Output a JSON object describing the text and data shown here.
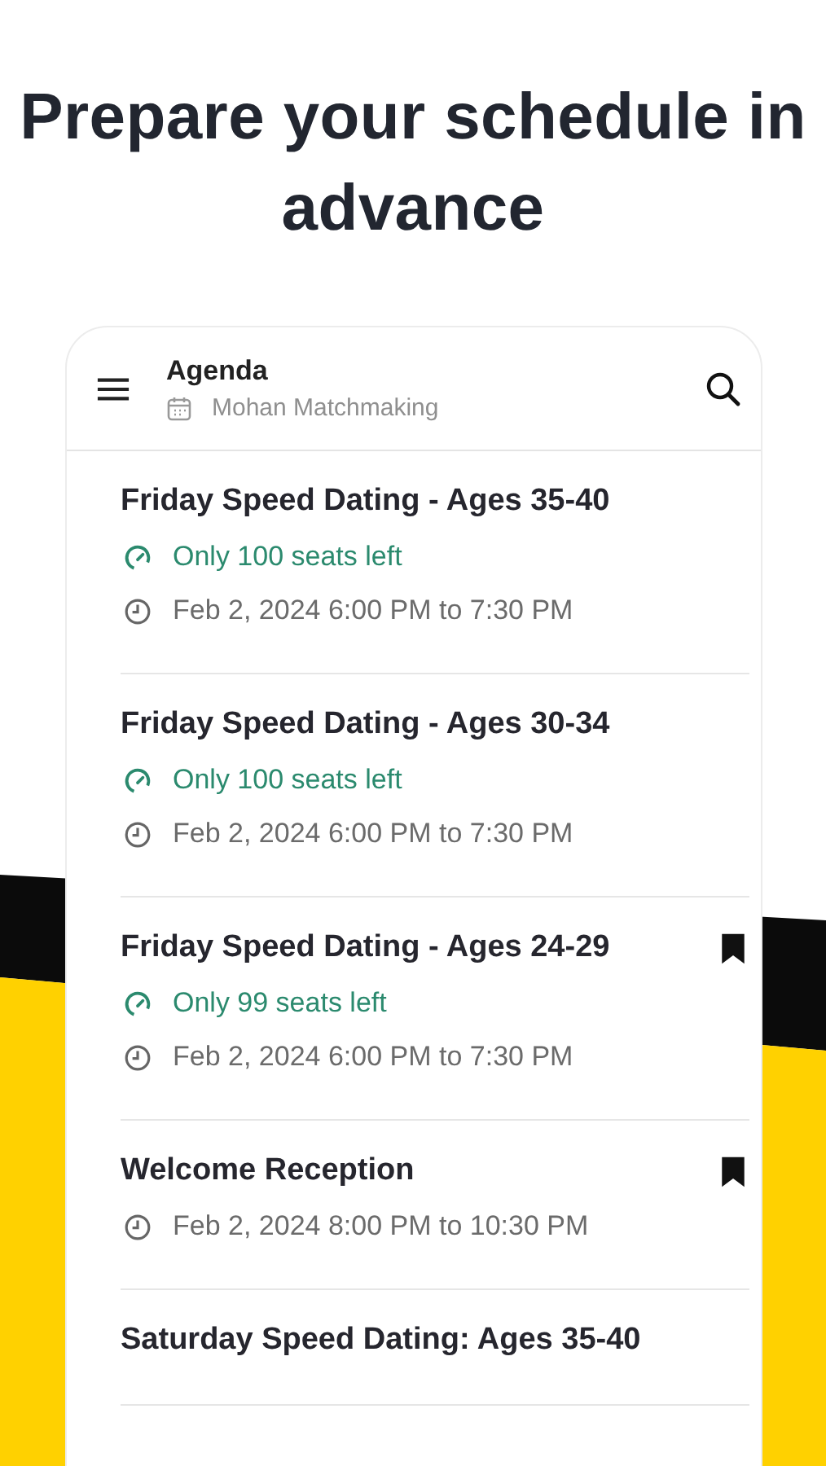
{
  "headline": "Prepare your schedule in advance",
  "app_bar": {
    "title": "Agenda",
    "subtitle": "Mohan Matchmaking"
  },
  "sessions": [
    {
      "title": "Friday Speed Dating - Ages 35-40",
      "seats": "Only 100 seats left",
      "time": "Feb 2, 2024 6:00 PM to 7:30 PM",
      "bookmarked": false
    },
    {
      "title": "Friday Speed Dating - Ages 30-34",
      "seats": "Only 100 seats left",
      "time": "Feb 2, 2024 6:00 PM to 7:30 PM",
      "bookmarked": false
    },
    {
      "title": "Friday Speed Dating - Ages 24-29",
      "seats": "Only 99 seats left",
      "time": "Feb 2, 2024 6:00 PM to 7:30 PM",
      "bookmarked": true
    },
    {
      "title": "Welcome Reception",
      "time": "Feb 2, 2024 8:00 PM to 10:30 PM",
      "bookmarked": true
    },
    {
      "title": "Saturday Speed Dating: Ages 35-40",
      "bookmarked": false
    }
  ]
}
